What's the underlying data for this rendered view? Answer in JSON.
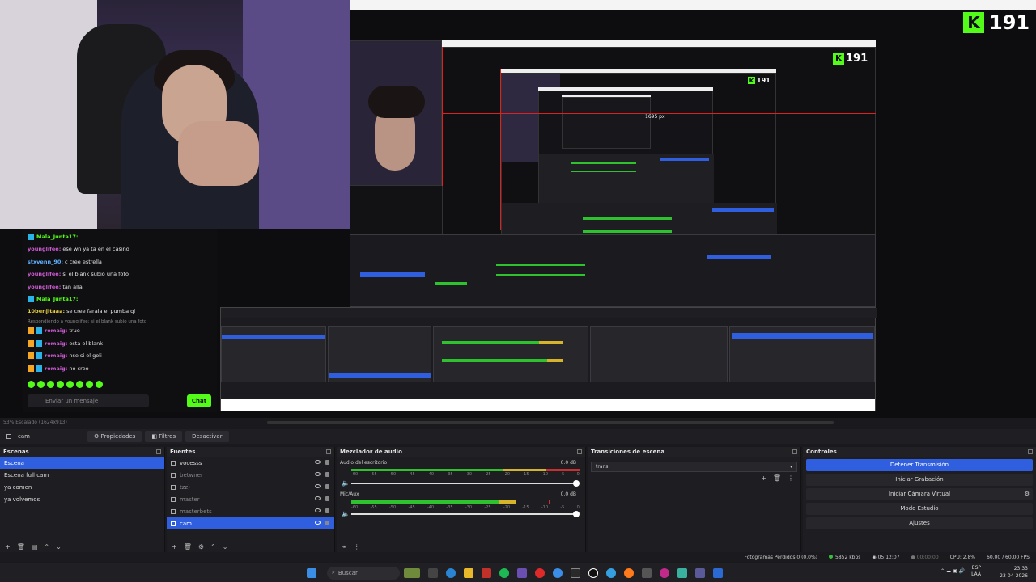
{
  "stream": {
    "kick_viewers": "191",
    "nested_viewers": "191",
    "nested_px_label": "1695 px"
  },
  "chat": {
    "lines": [
      {
        "user": "Mala_Junta17:",
        "text": "",
        "color": "g"
      },
      {
        "user": "younglifee:",
        "text": " ese wn ya ta en el casino",
        "color": "p"
      },
      {
        "user": "stxvenn_90:",
        "text": " c cree estrella",
        "color": "b"
      },
      {
        "user": "younglifee:",
        "text": " si el blank subio una foto",
        "color": "p"
      },
      {
        "user": "younglifee:",
        "text": " tan alla",
        "color": "p"
      },
      {
        "user": "Mala_Junta17:",
        "text": "",
        "color": "g"
      },
      {
        "user": "10benjitaaa:",
        "text": " se cree farala el pumba ql",
        "color": "y"
      },
      {
        "user": "",
        "text": "Respondiendo a younglifee: si el blank subio una foto",
        "color": "reply"
      },
      {
        "user": "romaig:",
        "text": " true",
        "color": "p"
      },
      {
        "user": "romaig:",
        "text": " esta el blank",
        "color": "p"
      },
      {
        "user": "romaig:",
        "text": " nse si el goli",
        "color": "p"
      },
      {
        "user": "romaig:",
        "text": " no creo",
        "color": "p"
      }
    ],
    "input_placeholder": "Enviar un mensaje",
    "send_button": "Chat"
  },
  "obs": {
    "status_left": "53%   Escalado (1624x913)",
    "scene_name": "cam",
    "toolbar": {
      "properties": "Propiedades",
      "filters": "Filtros",
      "deactivate": "Desactivar"
    },
    "scenes": {
      "title": "Escenas",
      "items": [
        "Escena",
        "Escena full cam",
        "ya comen",
        "ya volvemos"
      ]
    },
    "sources": {
      "title": "Fuentes",
      "items": [
        "vocesss",
        "betwner",
        "tzz)",
        "master",
        "masterbets",
        "cam"
      ]
    },
    "mixer": {
      "title": "Mezclador de audio",
      "ch1_name": "Audio del escritorio",
      "ch1_db": "0.0 dB",
      "ch2_name": "Mic/Aux",
      "ch2_db": "0.0 dB",
      "scale": [
        "-60",
        "-55",
        "-50",
        "-45",
        "-40",
        "-35",
        "-30",
        "-25",
        "-20",
        "-15",
        "-10",
        "-5",
        "0"
      ]
    },
    "transitions": {
      "title": "Transiciones de escena",
      "selected": "trans"
    },
    "controls": {
      "title": "Controles",
      "stop_stream": "Detener Transmisión",
      "start_rec": "Iniciar Grabación",
      "virtual_cam": "Iniciar Cámara Virtual",
      "studio": "Modo Estudio",
      "settings": "Ajustes"
    },
    "statusbar": {
      "dropped": "Fotogramas Perdidos 0 (0.0%)",
      "bitrate": "5852 kbps",
      "stream_time": "05:12:07",
      "rec_time": "00:00:00",
      "cpu": "CPU: 2.8%",
      "fps": "60.00 / 60.00 FPS"
    }
  },
  "taskbar": {
    "search": "Buscar",
    "lang": "ESP",
    "lang2": "LAA",
    "time": "23:33",
    "date": "23-04-2026"
  },
  "colors": {
    "accent_blue": "#2f5fde",
    "kick_green": "#53fc18",
    "meter_green": "#2ec22e",
    "meter_yellow": "#d5b32a",
    "meter_red": "#c83030"
  }
}
